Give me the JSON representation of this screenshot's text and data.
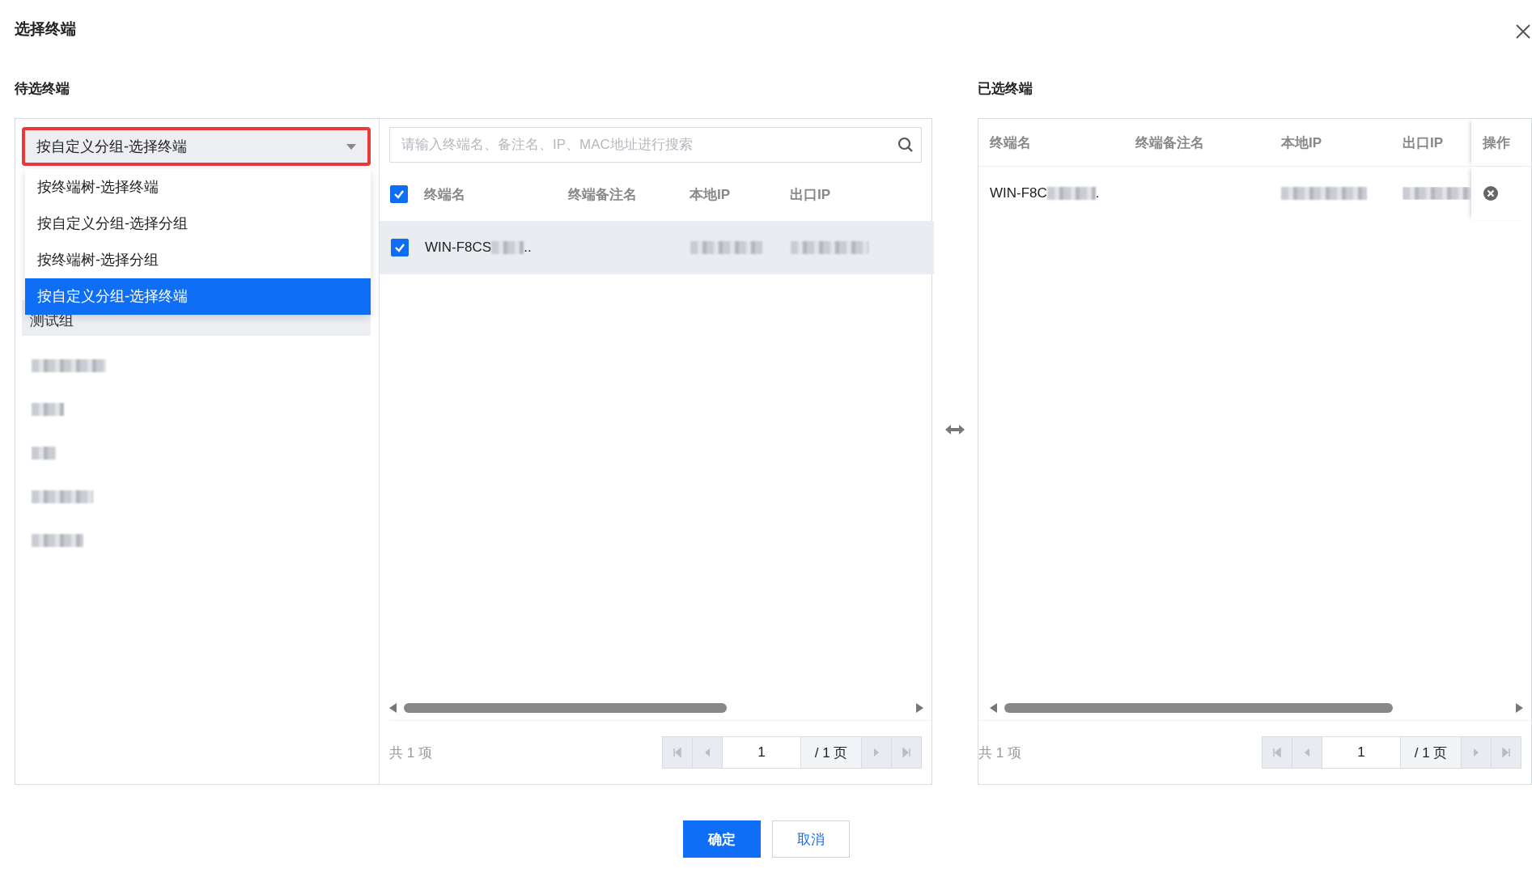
{
  "dialog": {
    "title": "选择终端",
    "confirm": "确定",
    "cancel": "取消"
  },
  "candidates": {
    "heading": "待选终端",
    "mode_select": {
      "value": "按自定义分组-选择终端",
      "options": [
        {
          "label": "按终端树-选择终端",
          "selected": false
        },
        {
          "label": "按自定义分组-选择分组",
          "selected": false
        },
        {
          "label": "按终端树-选择分组",
          "selected": false
        },
        {
          "label": "按自定义分组-选择终端",
          "selected": true
        }
      ]
    },
    "groups": [
      {
        "kind": "text",
        "label": "测试组",
        "selected": true
      },
      {
        "kind": "redacted",
        "selected": false
      },
      {
        "kind": "redacted",
        "selected": false
      },
      {
        "kind": "redacted",
        "selected": false
      },
      {
        "kind": "redacted",
        "selected": false
      },
      {
        "kind": "redacted",
        "selected": false
      }
    ],
    "search": {
      "placeholder": "请输入终端名、备注名、IP、MAC地址进行搜索"
    },
    "table": {
      "all_checked": true,
      "columns": [
        "终端名",
        "终端备注名",
        "本地IP",
        "出口IP"
      ],
      "rows": [
        {
          "checked": true,
          "name": "WIN-F8CS",
          "name_tail": "..",
          "name_redacted": true,
          "local_ip_redacted": true,
          "exit_ip_redacted": true
        }
      ]
    },
    "pagination": {
      "total": "共 1 项",
      "page": "1",
      "pages": "/ 1 页"
    }
  },
  "selected": {
    "heading": "已选终端",
    "table": {
      "columns": [
        "终端名",
        "终端备注名",
        "本地IP",
        "出口IP",
        "操作"
      ],
      "rows": [
        {
          "name": "WIN-F8C",
          "name_tail": ".",
          "name_redacted": true,
          "local_ip_redacted": true,
          "exit_ip_redacted": true
        }
      ]
    },
    "pagination": {
      "total": "共 1 项",
      "page": "1",
      "pages": "/ 1 页"
    }
  }
}
